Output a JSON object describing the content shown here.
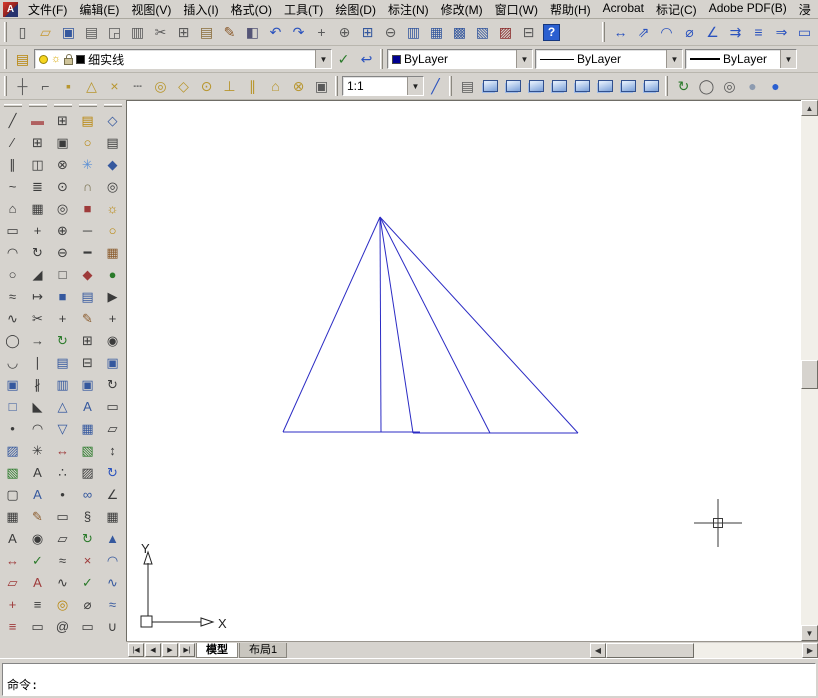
{
  "ui": {
    "app_icon": "A",
    "drop_arrow": "▼"
  },
  "menu": {
    "items": [
      "文件(F)",
      "编辑(E)",
      "视图(V)",
      "插入(I)",
      "格式(O)",
      "工具(T)",
      "绘图(D)",
      "标注(N)",
      "修改(M)",
      "窗口(W)",
      "帮助(H)",
      "Acrobat",
      "标记(C)",
      "Adobe PDF(B)",
      "浸"
    ]
  },
  "toolbars": {
    "standard": [
      [
        "new-file-icon",
        "▯",
        "#4a4a4a"
      ],
      [
        "open-icon",
        "▱",
        "#c79932"
      ],
      [
        "save-icon",
        "▣",
        "#35589e"
      ],
      [
        "plot-icon",
        "▤",
        "#5a5a5a"
      ],
      [
        "plot-preview-icon",
        "◲",
        "#5a5a5a"
      ],
      [
        "publish-icon",
        "▥",
        "#5a5a5a"
      ],
      [
        "cut-icon",
        "✂",
        "#5a5a5a"
      ],
      [
        "copy-clip-icon",
        "⊞",
        "#5a5a5a"
      ],
      [
        "paste-icon",
        "▤",
        "#8a6d3b"
      ],
      [
        "match-properties-icon",
        "✎",
        "#8a5a2b"
      ],
      [
        "block-editor-icon",
        "◧",
        "#555577"
      ],
      [
        "undo-icon",
        "↶",
        "#2a52be"
      ],
      [
        "redo-icon",
        "↷",
        "#2a52be"
      ],
      [
        "pan-realtime-icon",
        "+",
        "#5a5a5a"
      ],
      [
        "zoom-realtime-icon",
        "⊕",
        "#5a5a5a"
      ],
      [
        "zoom-window-icon",
        "⊞",
        "#35589e"
      ],
      [
        "zoom-previous-icon",
        "⊖",
        "#5a5a5a"
      ],
      [
        "properties-icon",
        "▥",
        "#35589e"
      ],
      [
        "designcenter-icon",
        "▦",
        "#35589e"
      ],
      [
        "tool-palettes-icon",
        "▩",
        "#35589e"
      ],
      [
        "sheet-set-manager-icon",
        "▧",
        "#35589e"
      ],
      [
        "markup-set-manager-icon",
        "▨",
        "#8a2a2a"
      ],
      [
        "quickcalc-icon",
        "⊟",
        "#5a5a5a"
      ],
      [
        "help-icon",
        "?",
        "",
        "ticon help"
      ]
    ],
    "dimension": [
      [
        "dim-linear-icon",
        "↔",
        "#2a52be"
      ],
      [
        "dim-aligned-icon",
        "⇗",
        "#2a52be"
      ],
      [
        "dim-radius-icon",
        "◠",
        "#2a52be"
      ],
      [
        "dim-diameter-icon",
        "⌀",
        "#2a52be"
      ],
      [
        "dim-angular-icon",
        "∠",
        "#2a52be"
      ],
      [
        "quick-dimension-icon",
        "⇉",
        "#2a52be"
      ],
      [
        "dim-baseline-icon",
        "≡",
        "#2a52be"
      ],
      [
        "dim-continue-icon",
        "⇒",
        "#2a52be"
      ],
      [
        "dim-style-icon",
        "▭",
        "#2a52be"
      ]
    ],
    "layers_left": [
      [
        "layer-properties-manager-icon",
        "▤",
        "#b8860b"
      ]
    ],
    "layers_right": [
      [
        "make-object-layer-current-icon",
        "✓",
        "#2a7a2a"
      ],
      [
        "layer-previous-icon",
        "↩",
        "#2a52be"
      ]
    ],
    "osnap": [
      [
        "snap-tracking-icon",
        "┼",
        "#5a5a5a"
      ],
      [
        "snap-from-icon",
        "⌐",
        "#5a5a5a"
      ],
      [
        "snap-endpoint-icon",
        "▪",
        "#b8962e"
      ],
      [
        "snap-midpoint-icon",
        "△",
        "#b8962e"
      ],
      [
        "snap-intersection-icon",
        "×",
        "#b8962e"
      ],
      [
        "snap-extension-icon",
        "┄",
        "#5a5a5a"
      ],
      [
        "snap-center-icon",
        "◎",
        "#b8962e"
      ],
      [
        "snap-quadrant-icon",
        "◇",
        "#b8962e"
      ],
      [
        "snap-tangent-icon",
        "⊙",
        "#b8962e"
      ],
      [
        "snap-perpendicular-icon",
        "⊥",
        "#b8962e"
      ],
      [
        "snap-parallel-icon",
        "∥",
        "#b8962e"
      ],
      [
        "snap-insert-icon",
        "⌂",
        "#b8962e"
      ],
      [
        "snap-node-icon",
        "⊗",
        "#b8962e"
      ],
      [
        "osnap-settings-icon",
        "▣",
        "#5a5a5a"
      ]
    ],
    "scale_extra": [
      [
        "scale-list-icon",
        "╱",
        "#2a52be"
      ]
    ],
    "views": [
      [
        "named-views-icon",
        "▤",
        "#5a5a5a"
      ],
      [
        "view-top-icon",
        "",
        "",
        "ticon cube"
      ],
      [
        "view-bottom-icon",
        "",
        "",
        "ticon cube"
      ],
      [
        "view-left-icon",
        "",
        "",
        "ticon cube"
      ],
      [
        "view-right-icon",
        "",
        "",
        "ticon cube"
      ],
      [
        "view-front-icon",
        "",
        "",
        "ticon cube"
      ],
      [
        "view-back-icon",
        "",
        "",
        "ticon cube"
      ],
      [
        "view-sw-isometric-icon",
        "",
        "",
        "ticon cube"
      ],
      [
        "view-se-isometric-icon",
        "",
        "",
        "ticon cube"
      ]
    ],
    "shade": [
      [
        "3d-orbit-icon",
        "↻",
        "#2a7a2a"
      ],
      [
        "shade-2d-wireframe-icon",
        "◯",
        "#5a5a5a"
      ],
      [
        "shade-3d-wireframe-icon",
        "◎",
        "#5a5a5a"
      ],
      [
        "shade-hidden-icon",
        "●",
        "#8d9bb0"
      ],
      [
        "shade-gouraud-icon",
        "●",
        "#2a5fd0"
      ]
    ]
  },
  "left_toolbars": [
    [
      [
        "line-icon",
        "╱",
        "#3b3b3b"
      ],
      [
        "construction-line-icon",
        "∕",
        "#3b3b3b"
      ],
      [
        "multiline-icon",
        "∥",
        "#3b3b3b"
      ],
      [
        "polyline-icon",
        "~",
        "#3b3b3b"
      ],
      [
        "polygon-icon",
        "⌂",
        "#3b3b3b"
      ],
      [
        "rectangle-icon",
        "▭",
        "#3b3b3b"
      ],
      [
        "arc-icon",
        "◠",
        "#3b3b3b"
      ],
      [
        "circle-icon",
        "○",
        "#3b3b3b"
      ],
      [
        "revision-cloud-icon",
        "≈",
        "#3b3b3b"
      ],
      [
        "spline-icon",
        "∿",
        "#3b3b3b"
      ],
      [
        "ellipse-icon",
        "◯",
        "#3b3b3b"
      ],
      [
        "ellipse-arc-icon",
        "◡",
        "#3b3b3b"
      ],
      [
        "insert-block-icon",
        "▣",
        "#35589e"
      ],
      [
        "make-block-icon",
        "□",
        "#35589e"
      ],
      [
        "point-icon",
        "•",
        "#3b3b3b"
      ],
      [
        "hatch-icon",
        "▨",
        "#35589e"
      ],
      [
        "gradient-icon",
        "▧",
        "#2a7a2a"
      ],
      [
        "region-icon",
        "▢",
        "#3b3b3b"
      ],
      [
        "table-icon",
        "▦",
        "#3b3b3b"
      ],
      [
        "mtext-icon",
        "A",
        "#3b3b3b"
      ],
      [
        "distance-icon",
        "↔",
        "#9e3a3a"
      ],
      [
        "area-icon",
        "▱",
        "#9e3a3a"
      ],
      [
        "id-point-icon",
        "+",
        "#9e3a3a"
      ],
      [
        "list-icon",
        "≡",
        "#9e3a3a"
      ]
    ],
    [
      [
        "erase-icon",
        "▬",
        "#b06060"
      ],
      [
        "copy-icon",
        "⊞",
        "#3b3b3b"
      ],
      [
        "mirror-icon",
        "◫",
        "#3b3b3b"
      ],
      [
        "offset-icon",
        "≣",
        "#3b3b3b"
      ],
      [
        "array-icon",
        "▦",
        "#3b3b3b"
      ],
      [
        "move-icon",
        "+",
        "#3b3b3b"
      ],
      [
        "rotate-icon",
        "↻",
        "#3b3b3b"
      ],
      [
        "scale-object-icon",
        "◢",
        "#3b3b3b"
      ],
      [
        "stretch-icon",
        "↦",
        "#3b3b3b"
      ],
      [
        "trim-icon",
        "✂",
        "#3b3b3b"
      ],
      [
        "extend-icon",
        "→",
        "#3b3b3b"
      ],
      [
        "break-at-point-icon",
        "∣",
        "#3b3b3b"
      ],
      [
        "break-icon",
        "∦",
        "#3b3b3b"
      ],
      [
        "chamfer-icon",
        "◣",
        "#3b3b3b"
      ],
      [
        "fillet-icon",
        "◠",
        "#3b3b3b"
      ],
      [
        "explode-icon",
        "✳",
        "#3b3b3b"
      ],
      [
        "text-icon",
        "A",
        "#3b3b3b"
      ],
      [
        "text-style-icon",
        "A",
        "#35589e"
      ],
      [
        "edit-text-icon",
        "✎",
        "#8a5a2b"
      ],
      [
        "find-icon",
        "◉",
        "#3b3b3b"
      ],
      [
        "spell-icon",
        "✓",
        "#2a7a2a"
      ],
      [
        "scale-text-icon",
        "A",
        "#9e3a3a"
      ],
      [
        "justify-text-icon",
        "≡",
        "#3b3b3b"
      ],
      [
        "convert-text-icon",
        "▭",
        "#3b3b3b"
      ]
    ],
    [
      [
        "zoom-window2-icon",
        "⊞",
        "#3b3b3b"
      ],
      [
        "zoom-dynamic-icon",
        "▣",
        "#3b3b3b"
      ],
      [
        "zoom-scale-icon",
        "⊗",
        "#3b3b3b"
      ],
      [
        "zoom-center-icon",
        "⊙",
        "#3b3b3b"
      ],
      [
        "zoom-object-icon",
        "◎",
        "#3b3b3b"
      ],
      [
        "zoom-in-icon",
        "⊕",
        "#3b3b3b"
      ],
      [
        "zoom-out-icon",
        "⊖",
        "#3b3b3b"
      ],
      [
        "zoom-all-icon",
        "□",
        "#3b3b3b"
      ],
      [
        "zoom-extents-icon",
        "■",
        "#35589e"
      ],
      [
        "pan-icon",
        "+",
        "#3b3b3b"
      ],
      [
        "orbit-icon",
        "↻",
        "#2a7a2a"
      ],
      [
        "draw-order-front-icon",
        "▤",
        "#35589e"
      ],
      [
        "draw-order-back-icon",
        "▥",
        "#35589e"
      ],
      [
        "draw-order-above-icon",
        "△",
        "#35589e"
      ],
      [
        "draw-order-below-icon",
        "▽",
        "#35589e"
      ],
      [
        "measure-icon",
        "↔",
        "#9e3a3a"
      ],
      [
        "divide-icon",
        "∴",
        "#3b3b3b"
      ],
      [
        "point-style-icon",
        "•",
        "#3b3b3b"
      ],
      [
        "boundary-icon",
        "▭",
        "#3b3b3b"
      ],
      [
        "wipeout-icon",
        "▱",
        "#3b3b3b"
      ],
      [
        "revcloud2-icon",
        "≈",
        "#3b3b3b"
      ],
      [
        "sketch-icon",
        "∿",
        "#3b3b3b"
      ],
      [
        "donut-icon",
        "◎",
        "#b8860b"
      ],
      [
        "helix-icon",
        "@",
        "#3b3b3b"
      ]
    ],
    [
      [
        "layer-icon",
        "▤",
        "#b8860b"
      ],
      [
        "layer-off-icon",
        "○",
        "#b8860b"
      ],
      [
        "layer-freeze-icon",
        "✳",
        "#5a8fd6"
      ],
      [
        "layer-lock-icon",
        "∩",
        "#77704e"
      ],
      [
        "layer-color-icon",
        "■",
        "#9e3a3a"
      ],
      [
        "linetype-icon",
        "─",
        "#3b3b3b"
      ],
      [
        "lineweight-icon",
        "━",
        "#3b3b3b"
      ],
      [
        "color-control-icon",
        "◆",
        "#9e3a3a"
      ],
      [
        "properties2-icon",
        "▤",
        "#35589e"
      ],
      [
        "match-layer-icon",
        "✎",
        "#8a5a2b"
      ],
      [
        "group-icon",
        "⊞",
        "#3b3b3b"
      ],
      [
        "ungroup-icon",
        "⊟",
        "#3b3b3b"
      ],
      [
        "block-icon",
        "▣",
        "#35589e"
      ],
      [
        "attribute-icon",
        "A",
        "#35589e"
      ],
      [
        "external-ref-icon",
        "▦",
        "#35589e"
      ],
      [
        "image-icon",
        "▧",
        "#2a7a2a"
      ],
      [
        "ole-icon",
        "▨",
        "#3b3b3b"
      ],
      [
        "hyperlink-icon",
        "∞",
        "#35589e"
      ],
      [
        "field-icon",
        "§",
        "#3b3b3b"
      ],
      [
        "update-icon",
        "↻",
        "#2a7a2a"
      ],
      [
        "purge-icon",
        "×",
        "#9e3a3a"
      ],
      [
        "audit-icon",
        "✓",
        "#2a7a2a"
      ],
      [
        "units-icon",
        "⌀",
        "#3b3b3b"
      ],
      [
        "limits-icon",
        "▭",
        "#3b3b3b"
      ]
    ],
    [
      [
        "view-control-icon",
        "◇",
        "#35589e"
      ],
      [
        "named-view-icon",
        "▤",
        "#3b3b3b"
      ],
      [
        "3d-view-icon",
        "◆",
        "#35589e"
      ],
      [
        "camera-icon",
        "◎",
        "#3b3b3b"
      ],
      [
        "light-icon",
        "☼",
        "#b8860b"
      ],
      [
        "sun-properties-icon",
        "○",
        "#b8860b"
      ],
      [
        "material-icon",
        "▦",
        "#8a5a2b"
      ],
      [
        "render-icon",
        "●",
        "#2a7a2a"
      ],
      [
        "motion-icon",
        "▶",
        "#3b3b3b"
      ],
      [
        "walk-icon",
        "+",
        "#3b3b3b"
      ],
      [
        "steering-icon",
        "◉",
        "#3b3b3b"
      ],
      [
        "showmotion-icon",
        "▣",
        "#35589e"
      ],
      [
        "animation-icon",
        "↻",
        "#3b3b3b"
      ],
      [
        "section-icon",
        "▭",
        "#3b3b3b"
      ],
      [
        "flatshot-icon",
        "▱",
        "#3b3b3b"
      ],
      [
        "3d-move-icon",
        "↕",
        "#3b3b3b"
      ],
      [
        "3d-rotate-icon",
        "↻",
        "#2a52be"
      ],
      [
        "3d-align-icon",
        "∠",
        "#3b3b3b"
      ],
      [
        "3d-array-icon",
        "▦",
        "#3b3b3b"
      ],
      [
        "extrude-icon",
        "▲",
        "#35589e"
      ],
      [
        "revolve-icon",
        "◠",
        "#35589e"
      ],
      [
        "sweep-icon",
        "∿",
        "#35589e"
      ],
      [
        "loft-icon",
        "≈",
        "#35589e"
      ],
      [
        "union-icon",
        "∪",
        "#3b3b3b"
      ]
    ]
  ],
  "layers": {
    "layer_value": "细实线",
    "layer_color": "#000000"
  },
  "properties": {
    "color_value": "ByLayer",
    "color_swatch": "#000090",
    "linetype_value": "ByLayer",
    "lineweight_value": "ByLayer"
  },
  "scale": {
    "value": "1:1"
  },
  "tabs": {
    "model": "模型",
    "layout1": "布局1",
    "nav": [
      [
        "tab-first-icon",
        "|◀",
        "",
        "navbtn"
      ],
      [
        "tab-prev-icon",
        "◀",
        "",
        "navbtn"
      ],
      [
        "tab-next-icon",
        "▶",
        "",
        "navbtn"
      ],
      [
        "tab-last-icon",
        "▶|",
        "",
        "navbtn"
      ]
    ]
  },
  "scrollbar": {
    "up": "▲",
    "down": "▼",
    "left": "◀",
    "right": "▶"
  },
  "ucs": {
    "x_label": "X",
    "y_label": "Y"
  },
  "command": {
    "prompt": "命令:"
  },
  "drawing": {
    "stroke": "#2b2bc4",
    "lines": [
      [
        253,
        116,
        156,
        331
      ],
      [
        253,
        116,
        254,
        331
      ],
      [
        156,
        331,
        293,
        331
      ],
      [
        253,
        116,
        286,
        332
      ],
      [
        253,
        116,
        363,
        332
      ],
      [
        253,
        116,
        451,
        332
      ],
      [
        286,
        332,
        451,
        332
      ]
    ]
  }
}
